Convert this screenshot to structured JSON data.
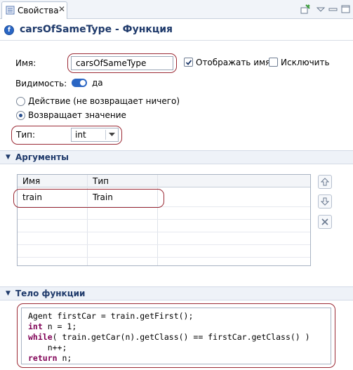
{
  "tab": {
    "label": "Свойства",
    "close": "✕"
  },
  "header": {
    "title": "carsOfSameType - Функция"
  },
  "form": {
    "name_label": "Имя:",
    "name_value": "carsOfSameType",
    "show_name_label": "Отображать имя",
    "exclude_label": "Исключить",
    "visibility_label": "Видимость:",
    "visibility_value": "да",
    "action_label": "Действие (не возвращает ничего)",
    "returns_label": "Возвращает значение",
    "type_label": "Тип:",
    "type_value": "int"
  },
  "arguments": {
    "section_title": "Аргументы",
    "columns": [
      "Имя",
      "Тип"
    ],
    "rows": [
      {
        "name": "train",
        "type": "Train"
      }
    ]
  },
  "body": {
    "section_title": "Тело функции",
    "lines": [
      "Agent firstCar = train.getFirst();",
      "int n = 1;",
      "while( train.getCar(n).getClass() == firstCar.getClass() )",
      "    n++;",
      "return n;"
    ]
  },
  "colors": {
    "highlight": "#9b2a35",
    "accent": "#2a66c4",
    "section_title": "#1f3a6b",
    "keyword": "#7f0055"
  }
}
